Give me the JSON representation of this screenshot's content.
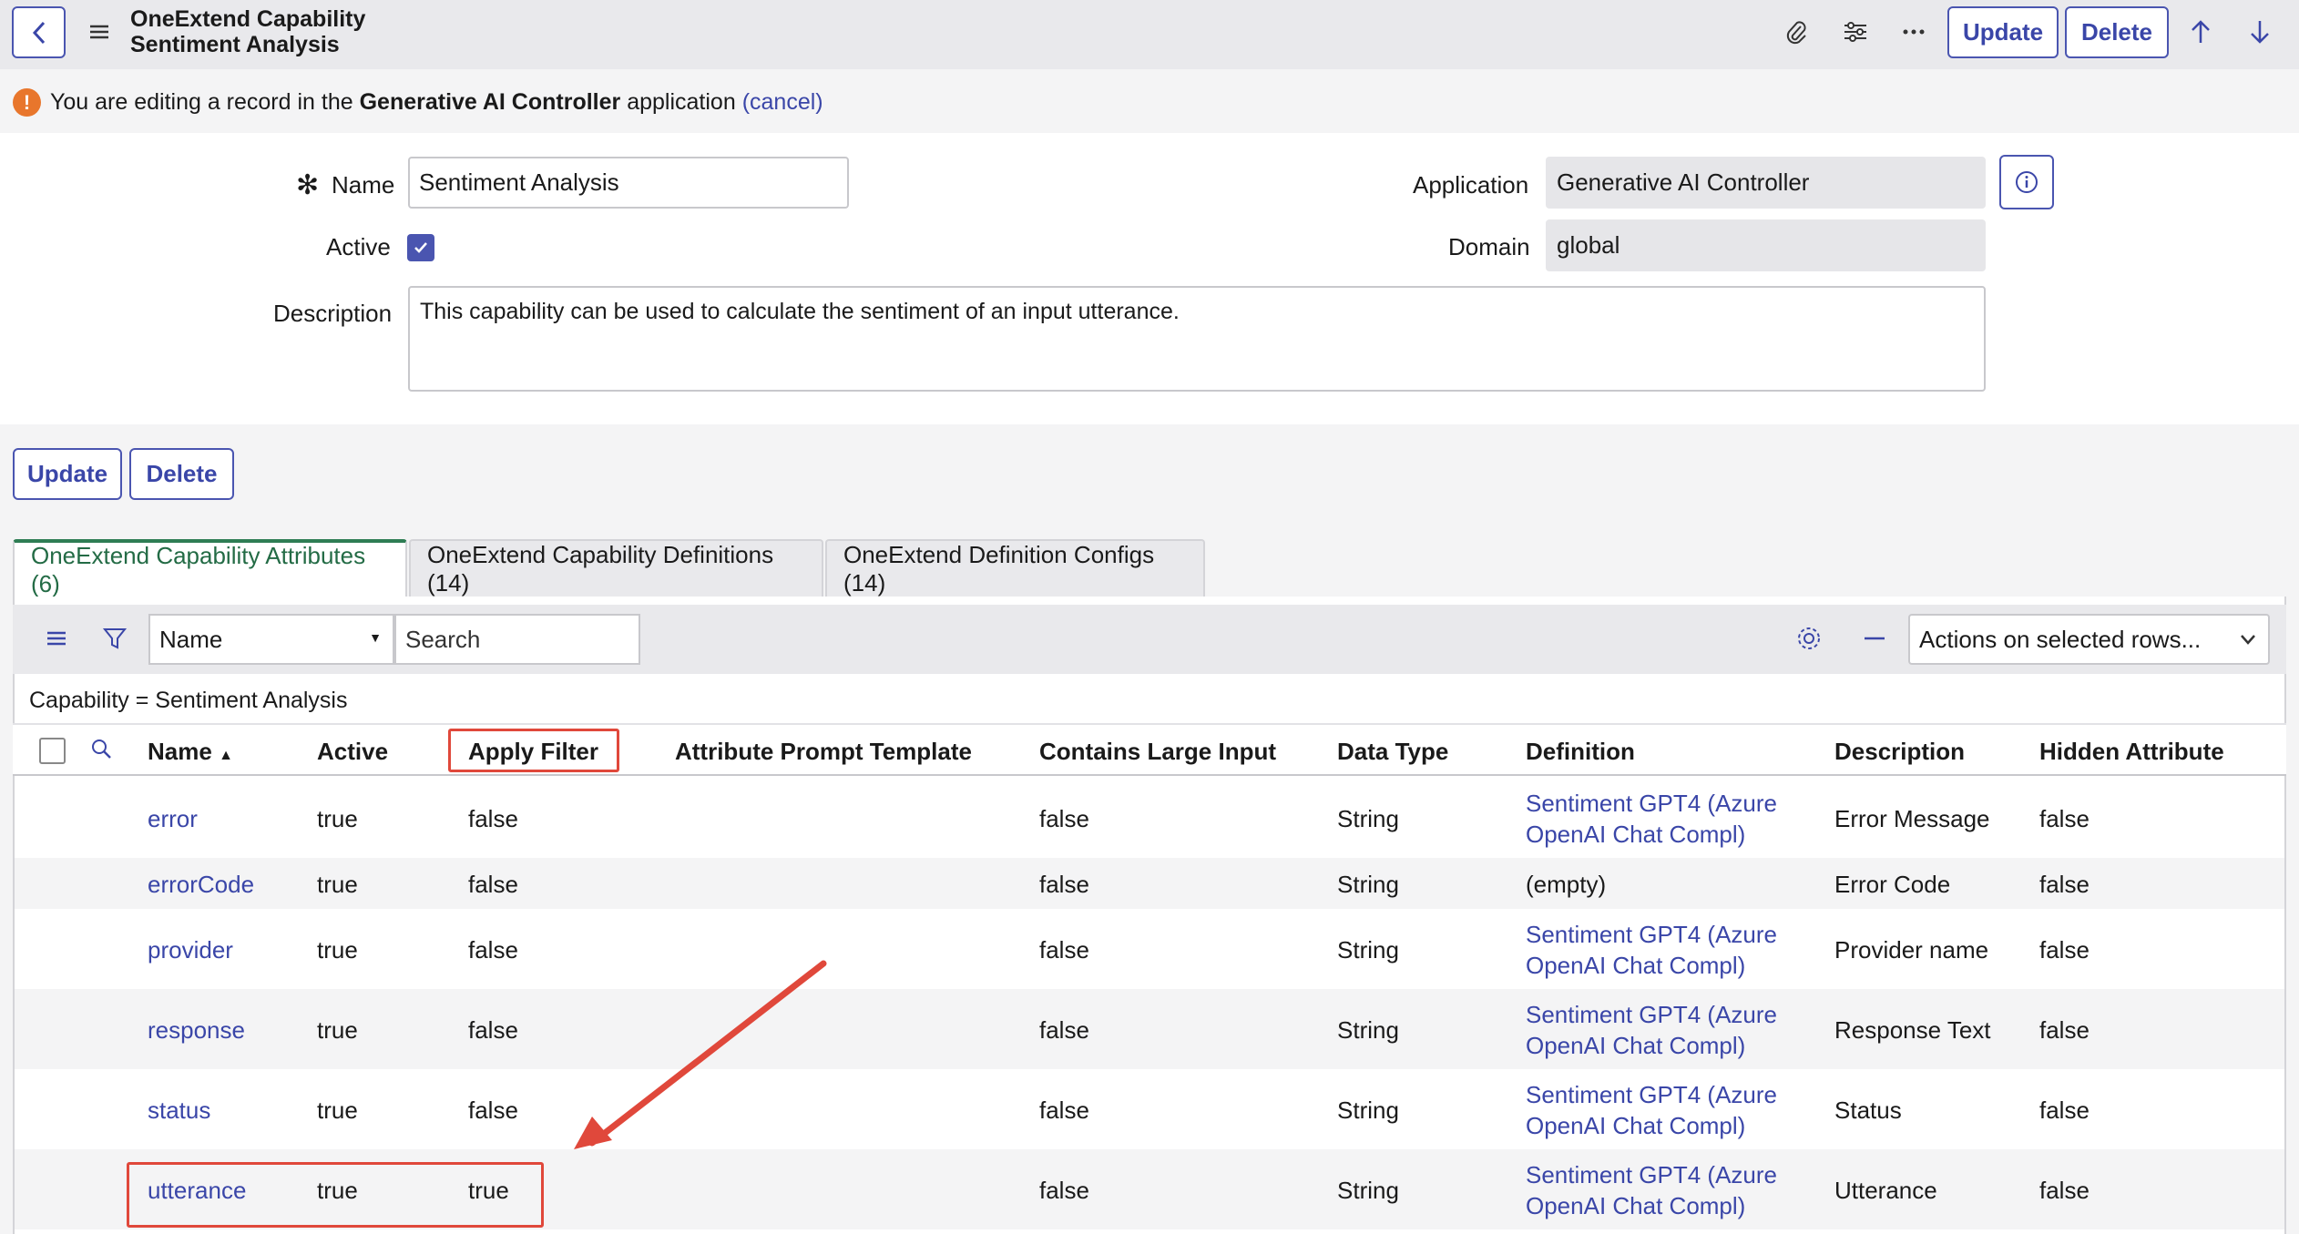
{
  "header": {
    "title_line1": "OneExtend Capability",
    "title_line2": "Sentiment Analysis",
    "update_label": "Update",
    "delete_label": "Delete"
  },
  "notice": {
    "prefix": "You are editing a record in the ",
    "app": "Generative AI Controller",
    "suffix": " application ",
    "cancel": "(cancel)"
  },
  "form": {
    "required_mark": "✻",
    "name_label": "Name",
    "name_value": "Sentiment Analysis",
    "active_label": "Active",
    "active_checked": true,
    "description_label": "Description",
    "description_value": "This capability can be used to calculate the sentiment of an input utterance.",
    "application_label": "Application",
    "application_value": "Generative AI Controller",
    "domain_label": "Domain",
    "domain_value": "global"
  },
  "actions": {
    "update_label": "Update",
    "delete_label": "Delete"
  },
  "tabs": [
    {
      "label": "OneExtend Capability Attributes (6)",
      "active": true
    },
    {
      "label": "OneExtend Capability Definitions (14)",
      "active": false
    },
    {
      "label": "OneExtend Definition Configs (14)",
      "active": false
    }
  ],
  "list": {
    "field_select": "Name",
    "search_placeholder": "Search",
    "actions_select": "Actions on selected rows...",
    "breadcrumb": "Capability = Sentiment Analysis",
    "columns": [
      "Name",
      "Active",
      "Apply Filter",
      "Attribute Prompt Template",
      "Contains Large Input",
      "Data Type",
      "Definition",
      "Description",
      "Hidden Attribute"
    ],
    "rows": [
      {
        "name": "error",
        "active": "true",
        "apply_filter": "false",
        "prompt_template": "",
        "large_input": "false",
        "data_type": "String",
        "definition_1": "Sentiment GPT4 (Azure",
        "definition_2": "OpenAI Chat Compl)",
        "description": "Error Message",
        "hidden": "false"
      },
      {
        "name": "errorCode",
        "active": "true",
        "apply_filter": "false",
        "prompt_template": "",
        "large_input": "false",
        "data_type": "String",
        "definition_1": "(empty)",
        "definition_2": "",
        "description": "Error Code",
        "hidden": "false"
      },
      {
        "name": "provider",
        "active": "true",
        "apply_filter": "false",
        "prompt_template": "",
        "large_input": "false",
        "data_type": "String",
        "definition_1": "Sentiment GPT4 (Azure",
        "definition_2": "OpenAI Chat Compl)",
        "description": "Provider name",
        "hidden": "false"
      },
      {
        "name": "response",
        "active": "true",
        "apply_filter": "false",
        "prompt_template": "",
        "large_input": "false",
        "data_type": "String",
        "definition_1": "Sentiment GPT4 (Azure",
        "definition_2": "OpenAI Chat Compl)",
        "description": "Response Text",
        "hidden": "false"
      },
      {
        "name": "status",
        "active": "true",
        "apply_filter": "false",
        "prompt_template": "",
        "large_input": "false",
        "data_type": "String",
        "definition_1": "Sentiment GPT4 (Azure",
        "definition_2": "OpenAI Chat Compl)",
        "description": "Status",
        "hidden": "false"
      },
      {
        "name": "utterance",
        "active": "true",
        "apply_filter": "true",
        "prompt_template": "",
        "large_input": "false",
        "data_type": "String",
        "definition_1": "Sentiment GPT4 (Azure",
        "definition_2": "OpenAI Chat Compl)",
        "description": "Utterance",
        "hidden": "false"
      }
    ]
  },
  "colors": {
    "accent": "#3a46a8",
    "active_tab": "#2e7d54",
    "annotation": "#e0483b",
    "warning": "#e8762c"
  }
}
